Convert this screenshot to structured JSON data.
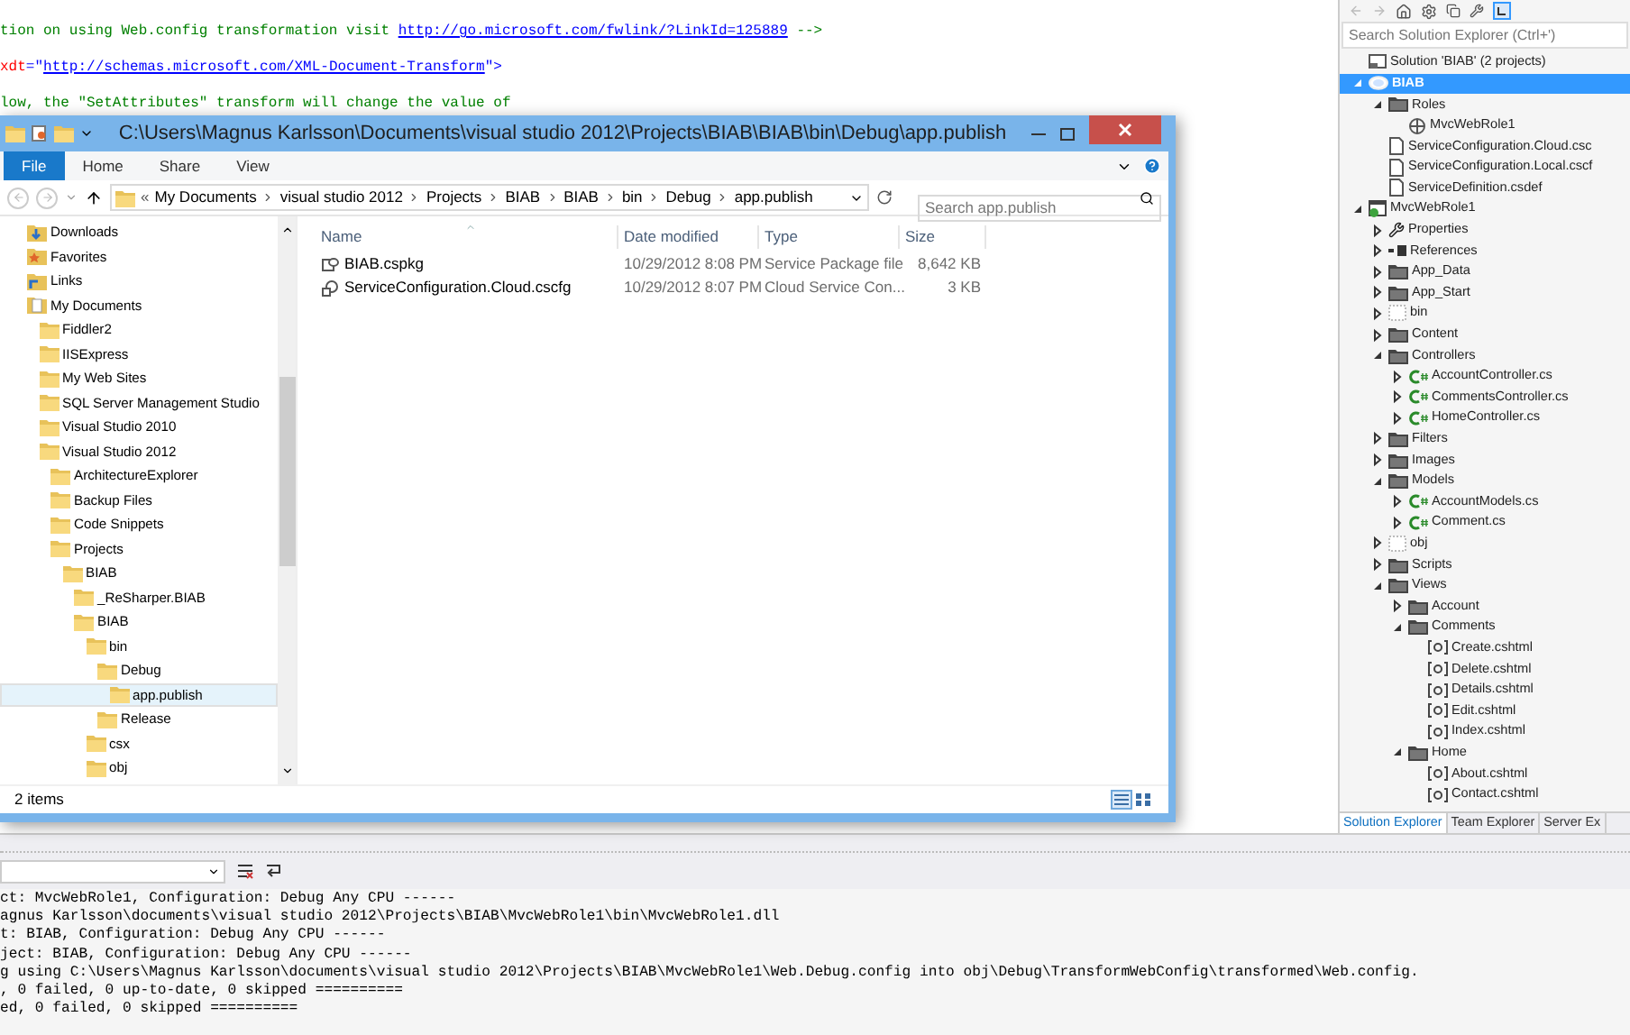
{
  "editor": {
    "lines": [
      {
        "segments": [
          {
            "kind": "comment",
            "text": "tion on using Web.config transformation visit "
          },
          {
            "kind": "link",
            "text": "http://go.microsoft.com/fwlink/?LinkId=125889"
          },
          {
            "kind": "comment",
            "text": " -->"
          }
        ]
      },
      {
        "segments": [
          {
            "kind": "attr",
            "text": "xdt"
          },
          {
            "kind": "punct",
            "text": "=\""
          },
          {
            "kind": "link",
            "text": "http://schemas.microsoft.com/XML-Document-Transform"
          },
          {
            "kind": "punct",
            "text": "\">"
          }
        ]
      },
      {
        "segments": [
          {
            "kind": "comment",
            "text": "low, the \"SetAttributes\" transform will change the value of"
          }
        ]
      }
    ]
  },
  "explorer": {
    "title": "C:\\Users\\Magnus Karlsson\\Documents\\visual studio 2012\\Projects\\BIAB\\BIAB\\bin\\Debug\\app.publish",
    "ribbon_tabs": [
      {
        "label": "File",
        "kind": "menu"
      },
      {
        "label": "Home",
        "kind": "tab"
      },
      {
        "label": "Share",
        "kind": "tab"
      },
      {
        "label": "View",
        "kind": "tab"
      }
    ],
    "address": {
      "prefix": "«",
      "crumbs": [
        "My Documents",
        "visual studio 2012",
        "Projects",
        "BIAB",
        "BIAB",
        "bin",
        "Debug",
        "app.publish"
      ]
    },
    "search": {
      "placeholder": "Search app.publish"
    },
    "nav": [
      {
        "label": "Downloads",
        "kind": "downloads",
        "selected": false
      },
      {
        "label": "Favorites",
        "kind": "favorites",
        "selected": false
      },
      {
        "label": "Links",
        "kind": "links",
        "selected": false
      },
      {
        "label": "My Documents",
        "kind": "documents",
        "selected": false,
        "children": [
          {
            "label": "Fiddler2",
            "kind": "folder",
            "selected": false
          },
          {
            "label": "IISExpress",
            "kind": "folder",
            "selected": false
          },
          {
            "label": "My Web Sites",
            "kind": "folder",
            "selected": false
          },
          {
            "label": "SQL Server Management Studio",
            "kind": "folder",
            "selected": false
          },
          {
            "label": "Visual Studio 2010",
            "kind": "folder",
            "selected": false
          },
          {
            "label": "Visual Studio 2012",
            "kind": "folder",
            "selected": false,
            "children": [
              {
                "label": "ArchitectureExplorer",
                "kind": "folder",
                "selected": false
              },
              {
                "label": "Backup Files",
                "kind": "folder",
                "selected": false
              },
              {
                "label": "Code Snippets",
                "kind": "folder",
                "selected": false
              },
              {
                "label": "Projects",
                "kind": "folder",
                "selected": false,
                "children": [
                  {
                    "label": "BIAB",
                    "kind": "folder",
                    "selected": false,
                    "children": [
                      {
                        "label": "_ReSharper.BIAB",
                        "kind": "folder",
                        "selected": false
                      },
                      {
                        "label": "BIAB",
                        "kind": "folder",
                        "selected": false,
                        "children": [
                          {
                            "label": "bin",
                            "kind": "folder",
                            "selected": false,
                            "children": [
                              {
                                "label": "Debug",
                                "kind": "folder",
                                "selected": false,
                                "children": [
                                  {
                                    "label": "app.publish",
                                    "kind": "folder",
                                    "selected": true
                                  }
                                ]
                              },
                              {
                                "label": "Release",
                                "kind": "folder",
                                "selected": false
                              }
                            ]
                          },
                          {
                            "label": "csx",
                            "kind": "folder",
                            "selected": false
                          },
                          {
                            "label": "obj",
                            "kind": "folder",
                            "selected": false
                          }
                        ]
                      }
                    ]
                  }
                ]
              }
            ]
          }
        ]
      }
    ],
    "columns": [
      "Name",
      "Date modified",
      "Type",
      "Size"
    ],
    "files": [
      {
        "name": "BIAB.cspkg",
        "kind": "package",
        "date": "10/29/2012 8:08 PM",
        "type": "Service Package file",
        "size": "8,642 KB"
      },
      {
        "name": "ServiceConfiguration.Cloud.cscfg",
        "kind": "config",
        "date": "10/29/2012 8:07 PM",
        "type": "Cloud Service Con...",
        "size": "3 KB"
      }
    ],
    "status": "2 items",
    "view_buttons": [
      {
        "kind": "details",
        "selected": true
      },
      {
        "kind": "tiles",
        "selected": false
      }
    ]
  },
  "output": {
    "lines": [
      "ct: MvcWebRole1, Configuration: Debug Any CPU ------",
      "agnus Karlsson\\documents\\visual studio 2012\\Projects\\BIAB\\MvcWebRole1\\bin\\MvcWebRole1.dll",
      "t: BIAB, Configuration: Debug Any CPU ------",
      "ject: BIAB, Configuration: Debug Any CPU ------",
      "g using C:\\Users\\Magnus Karlsson\\documents\\visual studio 2012\\Projects\\BIAB\\MvcWebRole1\\Web.Debug.config into obj\\Debug\\TransformWebConfig\\transformed\\Web.config.",
      ", 0 failed, 0 up-to-date, 0 skipped ==========",
      "ed, 0 failed, 0 skipped =========="
    ]
  },
  "solution_explorer": {
    "search": {
      "placeholder": "Search Solution Explorer (Ctrl+')"
    },
    "tree": [
      {
        "label": "Solution 'BIAB' (2 projects)",
        "kind": "solution",
        "selected": false
      },
      {
        "label": "BIAB",
        "kind": "cloud",
        "selected": true,
        "expanded": true,
        "children": [
          {
            "label": "Roles",
            "kind": "folder",
            "selected": false,
            "expanded": true,
            "children": [
              {
                "label": "MvcWebRole1",
                "kind": "role",
                "selected": false
              }
            ]
          },
          {
            "label": "ServiceConfiguration.Cloud.csc",
            "kind": "config",
            "selected": false
          },
          {
            "label": "ServiceConfiguration.Local.cscf",
            "kind": "config",
            "selected": false
          },
          {
            "label": "ServiceDefinition.csdef",
            "kind": "config",
            "selected": false
          }
        ]
      },
      {
        "label": "MvcWebRole1",
        "kind": "project",
        "selected": false,
        "expanded": true,
        "children": [
          {
            "label": "Properties",
            "kind": "properties",
            "selected": false,
            "expanded": false
          },
          {
            "label": "References",
            "kind": "references",
            "selected": false,
            "expanded": false
          },
          {
            "label": "App_Data",
            "kind": "folder",
            "selected": false,
            "expanded": false
          },
          {
            "label": "App_Start",
            "kind": "folder",
            "selected": false,
            "expanded": false
          },
          {
            "label": "bin",
            "kind": "hidden",
            "selected": false,
            "expanded": false
          },
          {
            "label": "Content",
            "kind": "folder",
            "selected": false,
            "expanded": false
          },
          {
            "label": "Controllers",
            "kind": "folder",
            "selected": false,
            "expanded": true,
            "children": [
              {
                "label": "AccountController.cs",
                "kind": "cs",
                "selected": false,
                "expanded": false
              },
              {
                "label": "CommentsController.cs",
                "kind": "cs",
                "selected": false,
                "expanded": false
              },
              {
                "label": "HomeController.cs",
                "kind": "cs",
                "selected": false,
                "expanded": false
              }
            ]
          },
          {
            "label": "Filters",
            "kind": "folder",
            "selected": false,
            "expanded": false
          },
          {
            "label": "Images",
            "kind": "folder",
            "selected": false,
            "expanded": false
          },
          {
            "label": "Models",
            "kind": "folder",
            "selected": false,
            "expanded": true,
            "children": [
              {
                "label": "AccountModels.cs",
                "kind": "cs",
                "selected": false,
                "expanded": false
              },
              {
                "label": "Comment.cs",
                "kind": "cs",
                "selected": false,
                "expanded": false
              }
            ]
          },
          {
            "label": "obj",
            "kind": "hidden",
            "selected": false,
            "expanded": false
          },
          {
            "label": "Scripts",
            "kind": "folder",
            "selected": false,
            "expanded": false
          },
          {
            "label": "Views",
            "kind": "folder",
            "selected": false,
            "expanded": true,
            "children": [
              {
                "label": "Account",
                "kind": "folder",
                "selected": false,
                "expanded": false
              },
              {
                "label": "Comments",
                "kind": "folder",
                "selected": false,
                "expanded": true,
                "children": [
                  {
                    "label": "Create.cshtml",
                    "kind": "cshtml",
                    "selected": false
                  },
                  {
                    "label": "Delete.cshtml",
                    "kind": "cshtml",
                    "selected": false
                  },
                  {
                    "label": "Details.cshtml",
                    "kind": "cshtml",
                    "selected": false
                  },
                  {
                    "label": "Edit.cshtml",
                    "kind": "cshtml",
                    "selected": false
                  },
                  {
                    "label": "Index.cshtml",
                    "kind": "cshtml",
                    "selected": false
                  }
                ]
              },
              {
                "label": "Home",
                "kind": "folder",
                "selected": false,
                "expanded": true,
                "children": [
                  {
                    "label": "About.cshtml",
                    "kind": "cshtml",
                    "selected": false
                  },
                  {
                    "label": "Contact.cshtml",
                    "kind": "cshtml",
                    "selected": false
                  }
                ]
              }
            ]
          }
        ]
      }
    ],
    "tabs": [
      {
        "label": "Solution Explorer",
        "selected": true
      },
      {
        "label": "Team Explorer",
        "selected": false
      },
      {
        "label": "Server Ex",
        "selected": false
      }
    ]
  }
}
